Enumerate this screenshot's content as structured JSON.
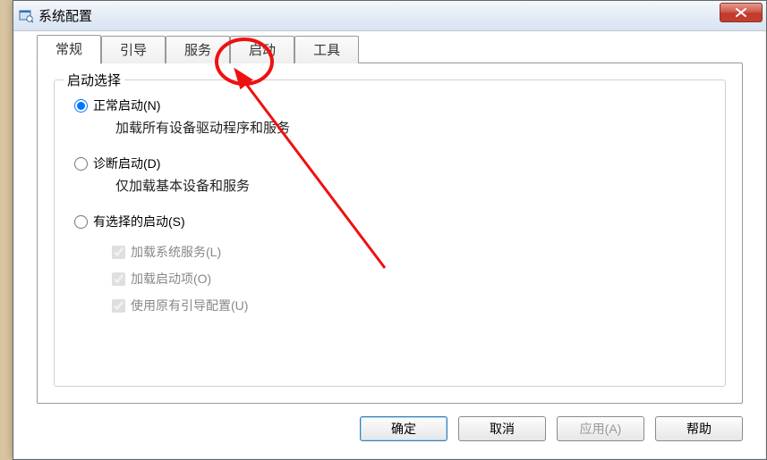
{
  "window": {
    "title": "系统配置"
  },
  "tabs": {
    "items": [
      {
        "label": "常规"
      },
      {
        "label": "引导"
      },
      {
        "label": "服务"
      },
      {
        "label": "启动"
      },
      {
        "label": "工具"
      }
    ],
    "active_index": 0
  },
  "groupbox": {
    "title": "启动选择"
  },
  "radios": {
    "normal": {
      "label": "正常启动(N)",
      "desc": "加载所有设备驱动程序和服务",
      "checked": true
    },
    "diag": {
      "label": "诊断启动(D)",
      "desc": "仅加载基本设备和服务",
      "checked": false
    },
    "select": {
      "label": "有选择的启动(S)",
      "desc": "",
      "checked": false
    }
  },
  "checks": {
    "services": {
      "label": "加载系统服务(L)",
      "checked": true,
      "disabled": true
    },
    "startup": {
      "label": "加载启动项(O)",
      "checked": true,
      "disabled": true
    },
    "origboot": {
      "label": "使用原有引导配置(U)",
      "checked": true,
      "disabled": true
    }
  },
  "buttons": {
    "ok": "确定",
    "cancel": "取消",
    "apply": "应用(A)",
    "help": "帮助"
  }
}
